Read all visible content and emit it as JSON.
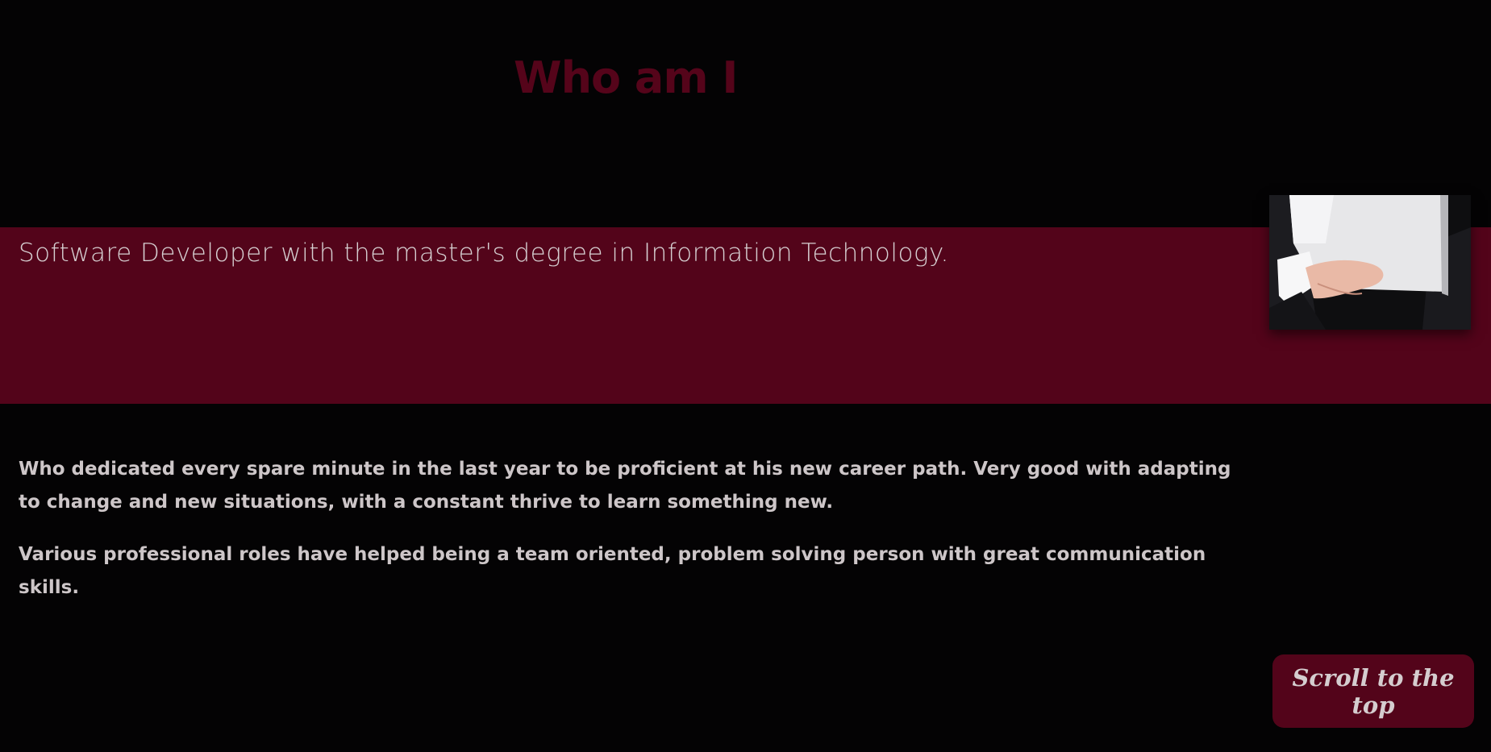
{
  "section": {
    "heading": "Who am I",
    "tagline": "Software Developer with the master's degree in Information Technology.",
    "paragraphs": [
      "Who dedicated every spare minute in the last year to be proficient at his new career path. Very good with adapting to change and new situations, with a constant thrive to learn something new.",
      "Various professional roles have helped being a team oriented, problem solving person with great communication skills."
    ]
  },
  "photo": {
    "icon": "businessman-holding-laptop-photo"
  },
  "scroll_button": {
    "label": "Scroll to the top"
  },
  "colors": {
    "background": "#040304",
    "accent": "#53041a",
    "text": "#cdc6c8"
  }
}
